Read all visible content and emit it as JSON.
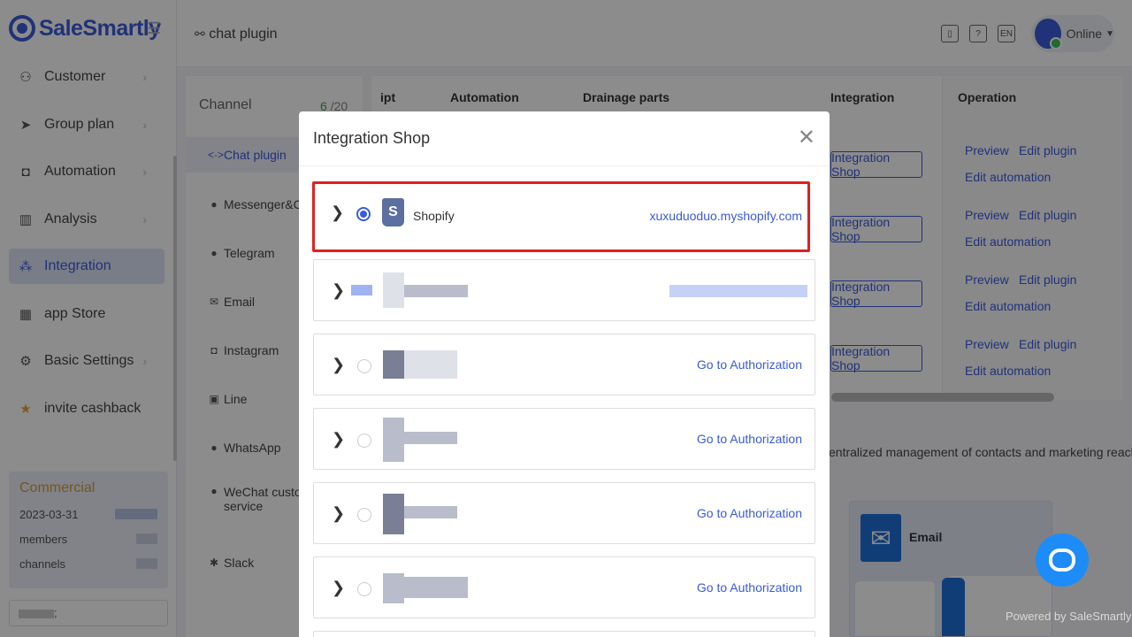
{
  "brand": {
    "name": "SaleSmartly"
  },
  "sidebar": {
    "items": [
      {
        "label": "Customer",
        "icon": "person-icon",
        "has_arrow": true
      },
      {
        "label": "Group plan",
        "icon": "send-icon",
        "has_arrow": true
      },
      {
        "label": "Automation",
        "icon": "robot-icon",
        "has_arrow": true
      },
      {
        "label": "Analysis",
        "icon": "bar-chart-icon",
        "has_arrow": true
      },
      {
        "label": "Integration",
        "icon": "integration-icon",
        "has_arrow": false,
        "active": true
      },
      {
        "label": "app Store",
        "icon": "grid-icon",
        "has_arrow": false
      },
      {
        "label": "Basic Settings",
        "icon": "gear-icon",
        "has_arrow": true
      },
      {
        "label": "invite cashback",
        "icon": "star-icon",
        "has_arrow": false
      }
    ],
    "plan": {
      "title": "Commercial",
      "date": "2023-03-31",
      "members_label": "members",
      "channels_label": "channels"
    },
    "user_suffix": ";"
  },
  "header": {
    "title": "chat plugin",
    "status": "Online",
    "lang": "EN",
    "help": "?"
  },
  "channels": {
    "title": "Channel",
    "count_used": "6",
    "count_total": "/20",
    "items": [
      {
        "label": "Chat plugin",
        "icon": "<·>",
        "active": true
      },
      {
        "label": "Messenger&Con",
        "icon": "●"
      },
      {
        "label": "Telegram",
        "icon": "●"
      },
      {
        "label": "Email",
        "icon": "✉"
      },
      {
        "label": "Instagram",
        "icon": "◘"
      },
      {
        "label": "Line",
        "icon": "▣"
      },
      {
        "label": "WhatsApp",
        "icon": "●"
      },
      {
        "label": "WeChat custom",
        "label2": "service",
        "icon": "●"
      },
      {
        "label": "Slack",
        "icon": "✱"
      }
    ]
  },
  "table": {
    "headers": [
      "ipt",
      "Automation",
      "Drainage parts",
      "Integration",
      "Operation"
    ],
    "rows": [
      {
        "integration_button": "Integration Shop",
        "preview": "Preview",
        "edit_plugin": "Edit plugin",
        "edit_automation": "Edit automation"
      },
      {
        "integration_button": "Integration Shop",
        "preview": "Preview",
        "edit_plugin": "Edit plugin",
        "edit_automation": "Edit automation"
      },
      {
        "integration_button": "Integration Shop",
        "preview": "Preview",
        "edit_plugin": "Edit plugin",
        "edit_automation": "Edit automation"
      },
      {
        "integration_button": "Integration Shop",
        "preview": "Preview",
        "edit_plugin": "Edit plugin",
        "edit_automation": "Edit automation"
      }
    ]
  },
  "promo": {
    "description": "entralized management of contacts and marketing reach",
    "card_label": "Email"
  },
  "widget": {
    "powered_by": "Powered by SaleSmartly"
  },
  "modal": {
    "title": "Integration Shop",
    "shops": [
      {
        "name": "Shopify",
        "action": "xuxuduoduo.myshopify.com",
        "selected": true
      },
      {
        "name": "",
        "action": "",
        "selected": false
      },
      {
        "name": "",
        "action": "Go to Authorization",
        "selected": false
      },
      {
        "name": "",
        "action": "Go to Authorization",
        "selected": false
      },
      {
        "name": "",
        "action": "Go to Authorization",
        "selected": false
      },
      {
        "name": "",
        "action": "Go to Authorization",
        "selected": false
      }
    ]
  }
}
